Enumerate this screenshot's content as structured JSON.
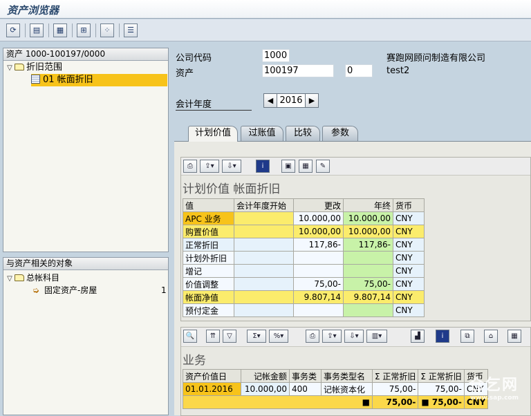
{
  "window": {
    "title": "资产浏览器"
  },
  "toolbar": {
    "buttons": [
      "refresh",
      "details",
      "display",
      "navigate",
      "structure",
      "list"
    ]
  },
  "tree_top": {
    "header": "资产 1000-100197/0000",
    "items": [
      {
        "label": "折旧范围"
      },
      {
        "label": "01  帐面折旧"
      }
    ]
  },
  "tree_bottom": {
    "header": "与资产相关的对象",
    "items": [
      {
        "label": "总帐科目"
      },
      {
        "label": "固定资产-房屋",
        "count": "1"
      }
    ]
  },
  "header": {
    "company_code_label": "公司代码",
    "company_code": "1000",
    "company_name": "赛跑网顾问制造有限公司",
    "asset_label": "资产",
    "asset_no": "100197",
    "sub_no": "0",
    "asset_desc": "test2",
    "fiscal_year_label": "会计年度",
    "fiscal_year": "2016"
  },
  "tabs": [
    {
      "label": "计划价值",
      "active": true
    },
    {
      "label": "过账值"
    },
    {
      "label": "比较"
    },
    {
      "label": "参数"
    }
  ],
  "grid1": {
    "title": "计划价值 帐面折旧",
    "columns": [
      "值",
      "会计年度开始",
      "更改",
      "年终",
      "货币"
    ],
    "rows": [
      {
        "name": "APC 业务",
        "start": "",
        "change": "10.000,00",
        "end": "10.000,00",
        "cur": "CNY"
      },
      {
        "name": "购置价值",
        "start": "",
        "change": "10.000,00",
        "end": "10.000,00",
        "cur": "CNY"
      },
      {
        "name": "正常折旧",
        "start": "",
        "change": "117,86-",
        "end": "117,86-",
        "cur": "CNY"
      },
      {
        "name": "计划外折旧",
        "start": "",
        "change": "",
        "end": "",
        "cur": "CNY"
      },
      {
        "name": "增记",
        "start": "",
        "change": "",
        "end": "",
        "cur": "CNY"
      },
      {
        "name": "价值调整",
        "start": "",
        "change": "75,00-",
        "end": "75,00-",
        "cur": "CNY"
      },
      {
        "name": "帐面净值",
        "start": "",
        "change": "9.807,14",
        "end": "9.807,14",
        "cur": "CNY"
      },
      {
        "name": "预付定金",
        "start": "",
        "change": "",
        "end": "",
        "cur": "CNY"
      }
    ]
  },
  "grid2": {
    "title": "业务",
    "columns": [
      "资产价值日",
      "记帐金额",
      "事务类",
      "事务类型名",
      "Σ 正常折旧",
      "Σ 正常折旧",
      "货币"
    ],
    "rows": [
      {
        "date": "01.01.2016",
        "amount": "10.000,00",
        "type": "400",
        "type_name": "记帐资本化",
        "dep1": "75,00-",
        "dep2": "75,00-",
        "cur": "CNY"
      }
    ],
    "total": {
      "marker": "■",
      "dep1": "75,00-",
      "marker2": "■",
      "dep2": "75,00-",
      "cur": "CNY"
    }
  },
  "watermark": {
    "text": "仓乞网",
    "sub": "www.sap.com"
  },
  "colors": {
    "selected": "#f7c31a",
    "yellow_cell": "#fbec6c",
    "green_cell": "#c8f2a8"
  }
}
